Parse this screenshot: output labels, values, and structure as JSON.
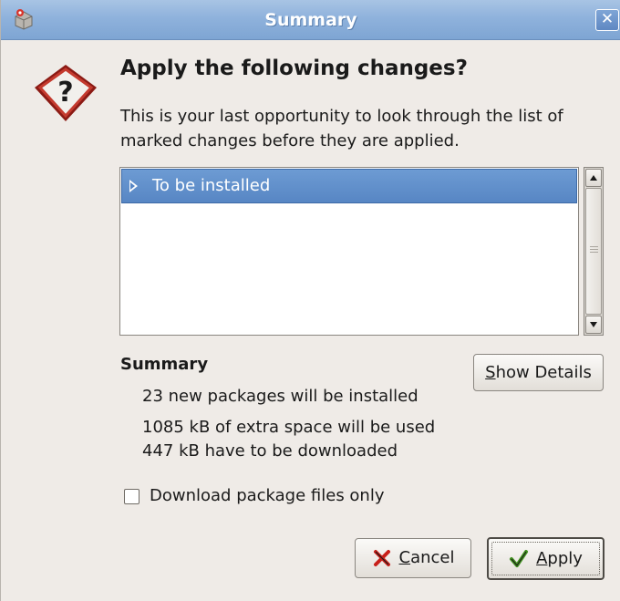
{
  "window": {
    "title": "Summary"
  },
  "dialog": {
    "heading": "Apply the following changes?",
    "description": "This is your last opportunity to look through the list of marked changes before they are applied."
  },
  "changes_list": {
    "rows": [
      {
        "label": "To be installed",
        "expanded": false,
        "selected": true
      }
    ]
  },
  "summary": {
    "label": "Summary",
    "show_details_prefix": "",
    "show_details_mnemonic": "S",
    "show_details_rest": "how Details",
    "stats": [
      "23 new packages will be installed",
      "1085 kB of extra space will be used",
      "447 kB have to be downloaded"
    ]
  },
  "options": {
    "download_only_label": "Download package files only",
    "download_only_checked": false
  },
  "buttons": {
    "cancel_mnemonic": "C",
    "cancel_rest": "ancel",
    "apply_mnemonic": "A",
    "apply_rest": "pply"
  },
  "colors": {
    "titlebar": "#8fb2dc",
    "selection": "#5786c4",
    "dialog_bg": "#efebe7",
    "cancel_icon": "#c8201a",
    "apply_icon": "#3f8f1f"
  },
  "icons": {
    "app": "synaptic-package-icon",
    "close": "close-icon",
    "question": "question-icon",
    "expander": "triangle-right-icon",
    "cancel": "cancel-x-icon",
    "apply": "checkmark-icon"
  }
}
